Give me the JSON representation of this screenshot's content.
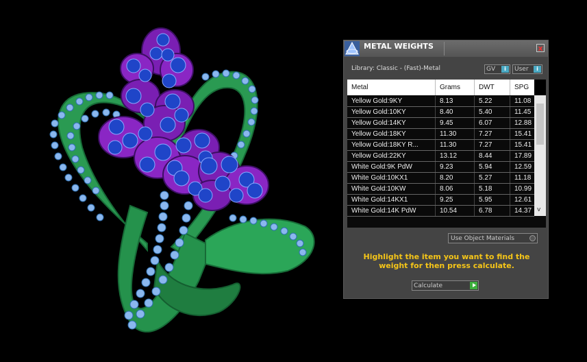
{
  "panel": {
    "title": "METAL WEIGHTS",
    "close_label": "x",
    "library_label": "Library: Classic - (Fast)-Metal",
    "gv_label": "GV",
    "user_label": "User",
    "info_glyph": "i",
    "use_object_materials_label": "Use Object Materials",
    "instructions": "Highlight the item you want to find the weight for then press calculate.",
    "calculate_label": "Calculate"
  },
  "table": {
    "columns": [
      "Metal",
      "Grams",
      "DWT",
      "SPG"
    ],
    "rows": [
      [
        "Yellow Gold:9KY",
        "8.13",
        "5.22",
        "11.08"
      ],
      [
        "Yellow Gold:10KY",
        "8.40",
        "5.40",
        "11.45"
      ],
      [
        "Yellow Gold:14KY",
        "9.45",
        "6.07",
        "12.88"
      ],
      [
        "Yellow Gold:18KY",
        "11.30",
        "7.27",
        "15.41"
      ],
      [
        "Yellow Gold:18KY R...",
        "11.30",
        "7.27",
        "15.41"
      ],
      [
        "Yellow Gold:22KY",
        "13.12",
        "8.44",
        "17.89"
      ],
      [
        "White Gold:9K PdW",
        "9.23",
        "5.94",
        "12.59"
      ],
      [
        "White Gold:10KX1",
        "8.20",
        "5.27",
        "11.18"
      ],
      [
        "White Gold:10KW",
        "8.06",
        "5.18",
        "10.99"
      ],
      [
        "White Gold:14KX1",
        "9.25",
        "5.95",
        "12.61"
      ],
      [
        "White Gold:14K PdW",
        "10.54",
        "6.78",
        "14.37"
      ]
    ]
  },
  "scroll": {
    "up": "^",
    "down": "v",
    "left": "<",
    "right": ">"
  },
  "viewport": {
    "subject": "3D jewelry model of heart-shaped ring with purple flower and blue gemstones"
  },
  "colors": {
    "accent_yellow": "#f5c518",
    "metal_green": "#27a855",
    "prong_purple": "#7a1fb3",
    "gem_blue": "#1f45c8",
    "accent_stone": "#8ab7ee"
  }
}
